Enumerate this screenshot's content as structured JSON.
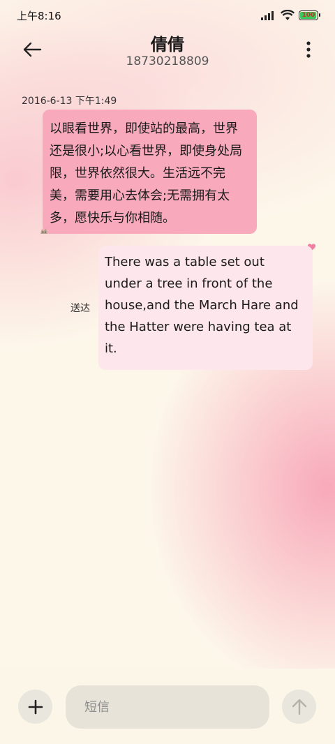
{
  "status_bar": {
    "time": "上午8:16",
    "battery": "100",
    "icons": [
      "signal-icon",
      "wifi-icon",
      "battery-icon"
    ]
  },
  "header": {
    "contact_name": "倩倩",
    "contact_number": "18730218809",
    "icons": [
      "back-arrow-icon",
      "more-vertical-icon"
    ]
  },
  "conversation": {
    "timestamp": "2016-6-13 下午1:49",
    "received_message": "以眼看世界，即使站的最高，世界还是很小;以心看世界，即使身处局限，世界依然很大。生活远不完美，需要用心去体会;无需拥有太多，愿快乐与你相随。",
    "sent_message": "There was a table set out under a tree in front of the house,and the March Hare and the Hatter were having tea at it.",
    "sent_status": "送达",
    "received_bubble_color": "#f9a9bc",
    "sent_bubble_color": "#fde6ec"
  },
  "composer": {
    "placeholder": "短信",
    "icons": [
      "plus-icon",
      "send-arrow-up-icon"
    ]
  }
}
